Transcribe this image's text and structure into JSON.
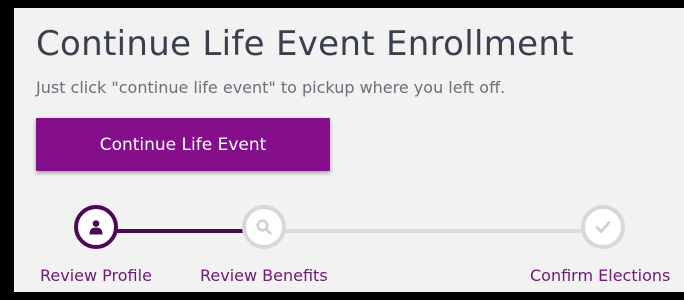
{
  "enrollment": {
    "title": "Continue Life Event Enrollment",
    "subtitle": "Just click \"continue life event\" to pickup where you left off.",
    "button_label": "Continue Life Event"
  },
  "steps": [
    {
      "label": "Review Profile",
      "icon": "user-icon",
      "state": "active"
    },
    {
      "label": "Review Benefits",
      "icon": "search-icon",
      "state": "pending"
    },
    {
      "label": "Confirm Elections",
      "icon": "check-icon",
      "state": "pending"
    }
  ],
  "colors": {
    "accent": "#850e8b",
    "active_step": "#4b0b54",
    "inactive_step": "#d8d8d8",
    "link_text": "#6d1a72"
  }
}
